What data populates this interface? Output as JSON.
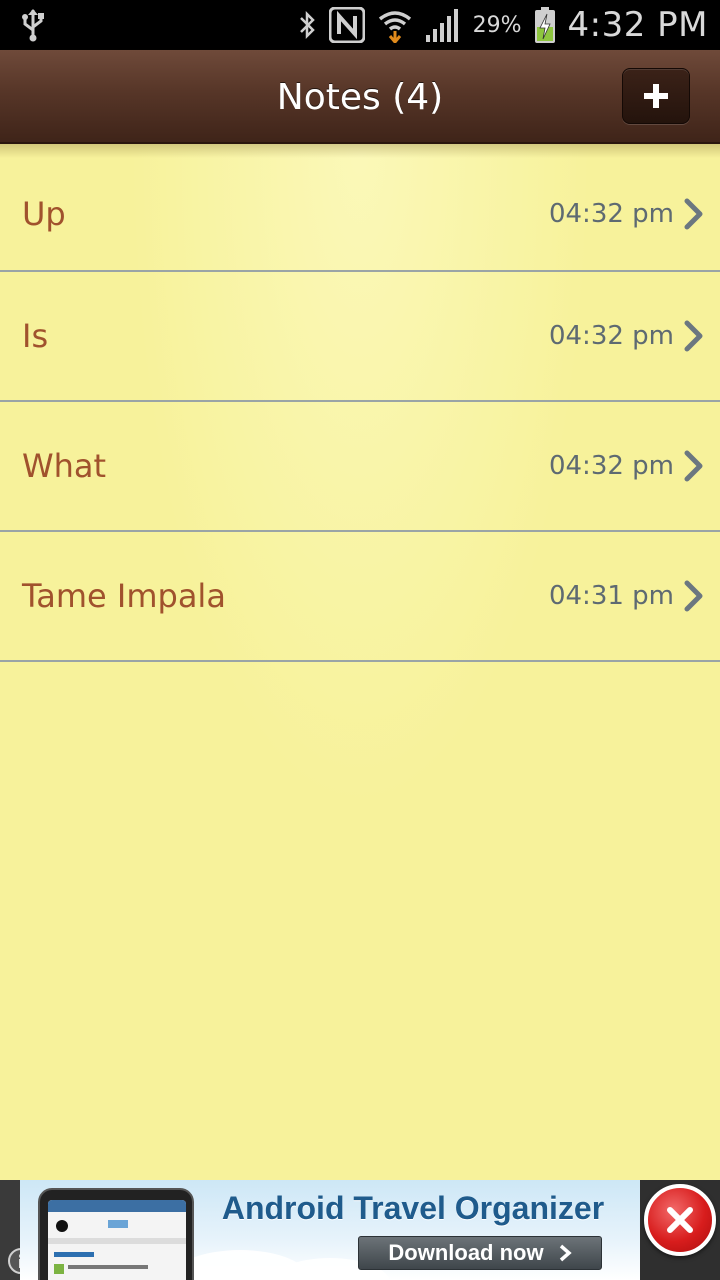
{
  "status_bar": {
    "battery_percent": "29%",
    "time": "4:32 PM",
    "icons": [
      "usb-icon",
      "bluetooth-icon",
      "nfc-icon",
      "wifi-icon",
      "signal-icon",
      "battery-charging-icon"
    ]
  },
  "header": {
    "title": "Notes (4)",
    "add_icon": "plus-icon"
  },
  "notes": [
    {
      "title": "Up",
      "time": "04:32 pm"
    },
    {
      "title": "Is",
      "time": "04:32 pm"
    },
    {
      "title": "What",
      "time": "04:32 pm"
    },
    {
      "title": "Tame Impala",
      "time": "04:31 pm"
    }
  ],
  "ad": {
    "headline": "Android Travel Organizer",
    "cta": "Download now",
    "close_icon": "close-icon",
    "info_icon": "info-icon"
  },
  "colors": {
    "header_brown": "#573628",
    "paper_yellow": "#f7f29b",
    "note_title": "#a0522d",
    "note_time": "#5e6a72",
    "divider": "#9aa4a6"
  }
}
